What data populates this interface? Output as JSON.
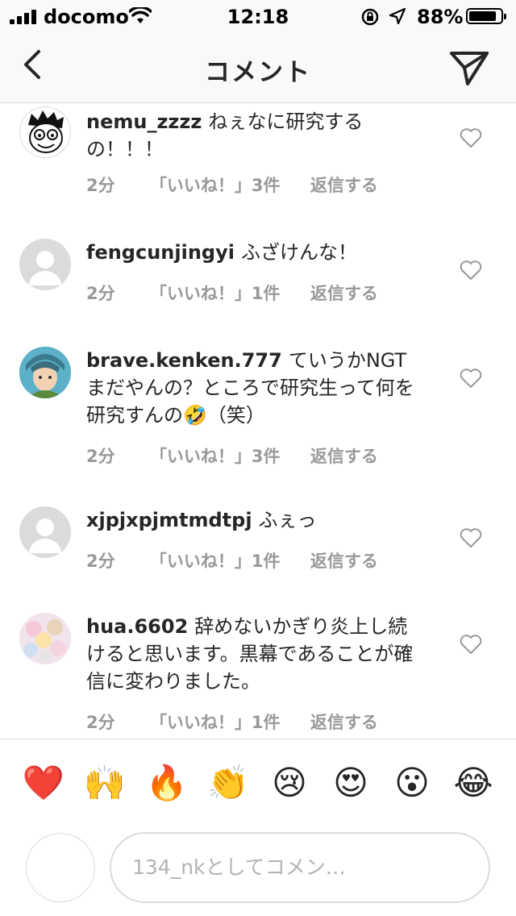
{
  "status_bar": {
    "carrier": "docomo",
    "time": "12:18",
    "battery_text": "88%",
    "battery_level": 0.88
  },
  "nav": {
    "title": "コメント",
    "icons": [
      "chevron-left-icon",
      "send-icon"
    ]
  },
  "comments": [
    {
      "username": "nemu_zzzz",
      "text": "ねぇなに研究するの！！！",
      "time": "2分",
      "likes": "「いいね！」3件",
      "reply": "返信する",
      "avatar": "cartoon"
    },
    {
      "username": "fengcunjingyi",
      "text": "ふざけんな！",
      "time": "2分",
      "likes": "「いいね！」1件",
      "reply": "返信する",
      "avatar": "default"
    },
    {
      "username": "brave.kenken.777",
      "text": "ていうかNGTまだやんの？ところで研究生って何を研究すんの🤣（笑）",
      "time": "2分",
      "likes": "「いいね！」3件",
      "reply": "返信する",
      "avatar": "character"
    },
    {
      "username": "xjpjxpjmtmdtpj",
      "text": "ふぇっ",
      "time": "2分",
      "likes": "「いいね！」1件",
      "reply": "返信する",
      "avatar": "default"
    },
    {
      "username": "hua.6602",
      "text": "辞めないかぎり炎上し続けると思います。黒幕であることが確信に変わりました。",
      "time": "2分",
      "likes": "「いいね！」1件",
      "reply": "返信する",
      "avatar": "plush"
    }
  ],
  "emoji_bar": [
    "❤️",
    "🙌",
    "🔥",
    "👏",
    "😢",
    "😍",
    "😮",
    "😂"
  ],
  "composer": {
    "placeholder": "134_nkとしてコメン…"
  },
  "colors": {
    "text": "#262626",
    "meta": "#999999",
    "divider": "#dbdbdb",
    "bar_bg": "#f9f9f9"
  }
}
